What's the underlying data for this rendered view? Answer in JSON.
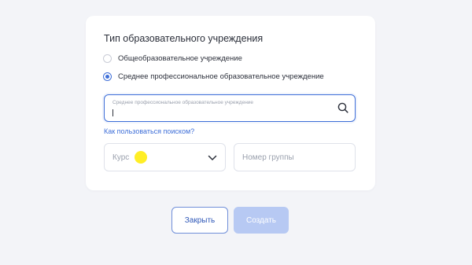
{
  "form": {
    "title": "Тип образовательного учреждения",
    "options": [
      {
        "label": "Общеобразовательное учреждение",
        "checked": false
      },
      {
        "label": "Среднее профессиональное образовательное учреждение",
        "checked": true
      }
    ],
    "search": {
      "label": "Среднее профессиональное образовательное учреждение",
      "value": "",
      "icon": "search-icon"
    },
    "help_link": "Как пользоваться поиском?",
    "course_select": {
      "value": "Курс",
      "icon": "chevron-down-icon"
    },
    "group_input": {
      "placeholder": "Номер группы",
      "value": ""
    }
  },
  "actions": {
    "close_label": "Закрыть",
    "create_label": "Создать"
  },
  "colors": {
    "accent": "#3f6fd8",
    "disabled_button": "#b7c9f3",
    "background": "#f3f4f8",
    "cursor_highlight": "#ffeb00"
  }
}
